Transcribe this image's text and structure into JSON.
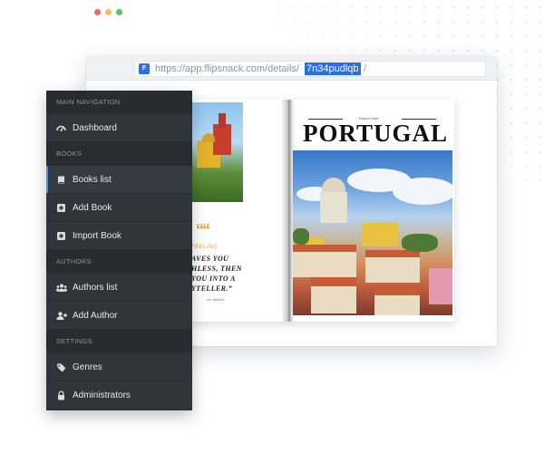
{
  "browser": {
    "url_prefix": "https://app.flipsnack.com/details/",
    "url_id": "7n34pudlqb",
    "url_suffix": "/"
  },
  "book": {
    "quote_label": "FEELING",
    "quote_lines": [
      "AVES YOU",
      "HLESS, THEN",
      "YOU INTO A",
      "YTELLER.”"
    ],
    "quote_author": "nin Bellulia",
    "cover_kicker": "Mysun Note",
    "cover_title": "PORTUGAL"
  },
  "sidebar": {
    "sections": [
      {
        "title": "MAIN NAVIGATION",
        "items": [
          {
            "label": "Dashboard",
            "icon": "dashboard-icon",
            "active": false
          }
        ]
      },
      {
        "title": "BOOKS",
        "items": [
          {
            "label": "Books list",
            "icon": "book-icon",
            "active": true
          },
          {
            "label": "Add Book",
            "icon": "plus-square-icon",
            "active": false
          },
          {
            "label": "Import Book",
            "icon": "plus-square-icon",
            "active": false
          }
        ]
      },
      {
        "title": "AUTHORS",
        "items": [
          {
            "label": "Authors list",
            "icon": "users-icon",
            "active": false
          },
          {
            "label": "Add Author",
            "icon": "user-plus-icon",
            "active": false
          }
        ]
      },
      {
        "title": "SETTINGS",
        "items": [
          {
            "label": "Genres",
            "icon": "tags-icon",
            "active": false
          },
          {
            "label": "Administrators",
            "icon": "lock-icon",
            "active": false
          }
        ]
      }
    ]
  }
}
